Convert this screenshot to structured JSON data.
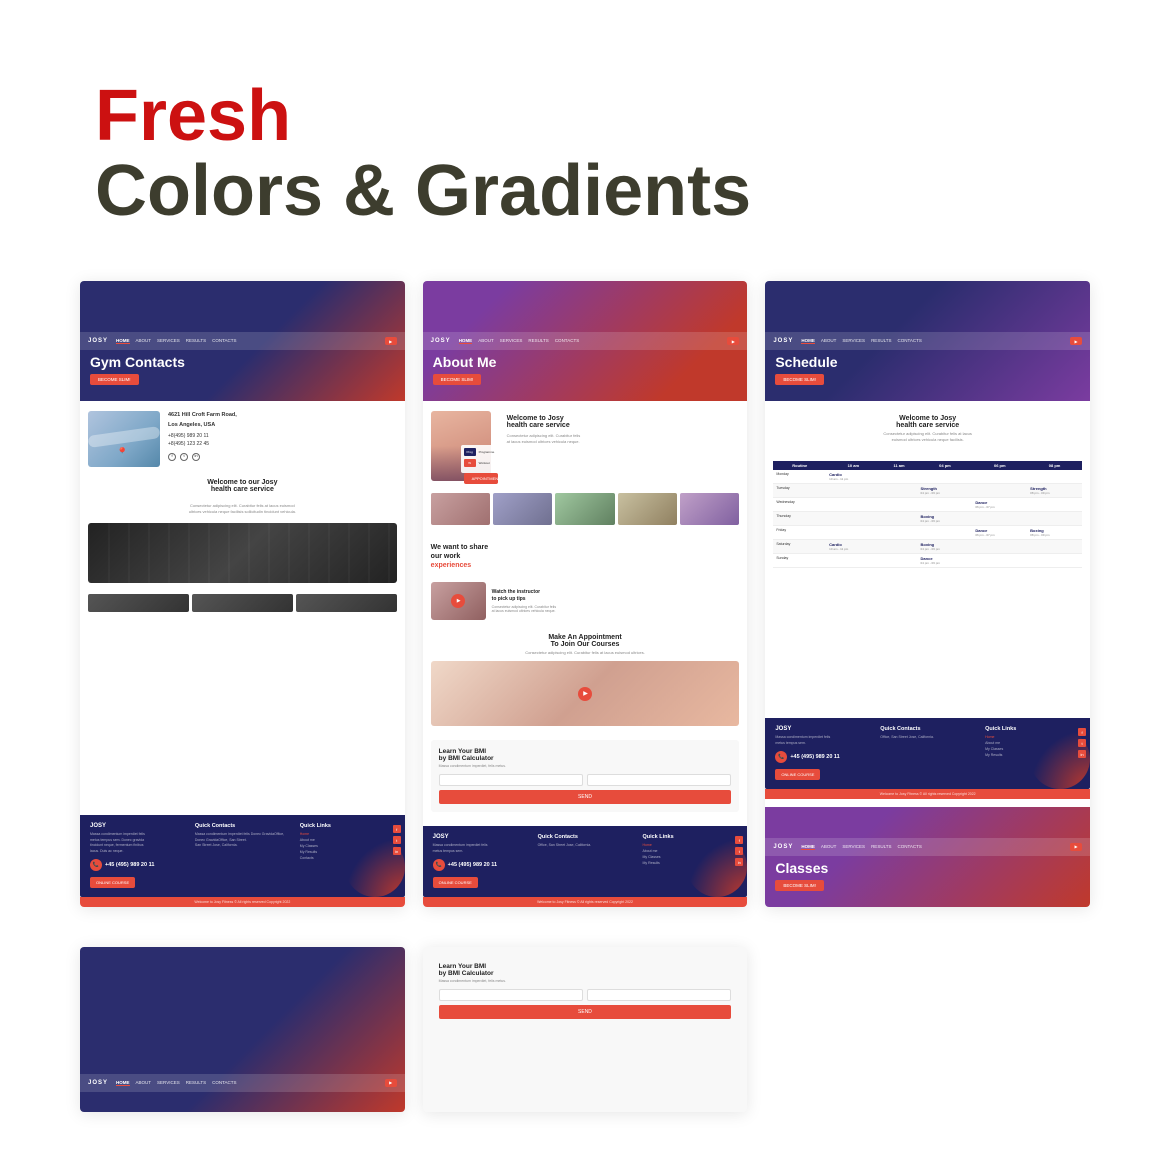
{
  "heading": {
    "fresh": "Fresh",
    "subtitle": "Colors & Gradients"
  },
  "cards": [
    {
      "id": "contacts",
      "hero_title": "Gym Contacts",
      "hero_btn": "BECOME SLIM!",
      "nav_logo": "JOSY",
      "nav_links": [
        "HOME",
        "ABOUT",
        "SERVICES",
        "RESULTS",
        "CONTACTS"
      ],
      "contact_address": "4621 Hill Croft Farm Road, Los Angeles, USA",
      "contact_phone1": "+8(495) 989 20 11",
      "contact_phone2": "+8(495) 123 22 45",
      "welcome_title": "Welcome to our Josy health care service",
      "welcome_text": "Consectetur adipiscing elit. Curabitur felis at lacus euismod ultrices vehicula neque facilisis."
    },
    {
      "id": "about",
      "hero_title": "About Me",
      "hero_btn": "BECOME SLIM!",
      "nav_logo": "JOSY",
      "nav_links": [
        "HOME",
        "ABOUT",
        "SERVICES",
        "RESULTS",
        "CONTACTS"
      ],
      "welcome_title": "Welcome to Josy health care service",
      "share_title": "We want to share our work",
      "share_highlight": "experiences",
      "video_title": "Watch the instructor to pick up tips",
      "appt_title": "Make An Appointment To Join Our Courses",
      "bmi_title": "Learn Your BMI by BMI Calculator",
      "bmi_sub": "Massa condimentum imperdiet, felis metus.",
      "bmi_send": "SEND"
    },
    {
      "id": "schedule",
      "hero_title": "Schedule",
      "hero_btn": "BECOME SLIM!",
      "nav_logo": "JOSY",
      "nav_links": [
        "HOME",
        "ABOUT",
        "SERVICES",
        "RESULTS",
        "CONTACTS"
      ],
      "welcome_title": "Welcome to Josy health care service",
      "table_headers": [
        "Routine",
        "10 am",
        "11 am",
        "04 pm",
        "06 pm",
        "08 pm"
      ],
      "table_rows": [
        [
          "Monday",
          "Cardio",
          "",
          "",
          "",
          ""
        ],
        [
          "Tuesday",
          "",
          "",
          "Strength",
          "",
          "Strength"
        ],
        [
          "Wednesday",
          "",
          "",
          "",
          "Dance",
          ""
        ],
        [
          "Thursday",
          "",
          "",
          "Boxing",
          "",
          ""
        ],
        [
          "Friday",
          "",
          "",
          "",
          "Dance",
          "Boxing"
        ],
        [
          "Saturday",
          "Cardio",
          "",
          "Boxing",
          "",
          ""
        ],
        [
          "Sunday",
          "",
          "",
          "Dance",
          "",
          ""
        ]
      ],
      "classes_title": "Classes"
    }
  ],
  "footer": {
    "logo": "JOSY",
    "contacts_title": "Quick Contacts",
    "links_title": "Quick Links",
    "phone": "+45 (495) 989 20 11",
    "online_btn": "ONLINE COURSE",
    "copyright": "Welcome to Josy Fitness © All rights reserved Copyright 2022",
    "social": [
      "f",
      "t",
      "in"
    ]
  }
}
